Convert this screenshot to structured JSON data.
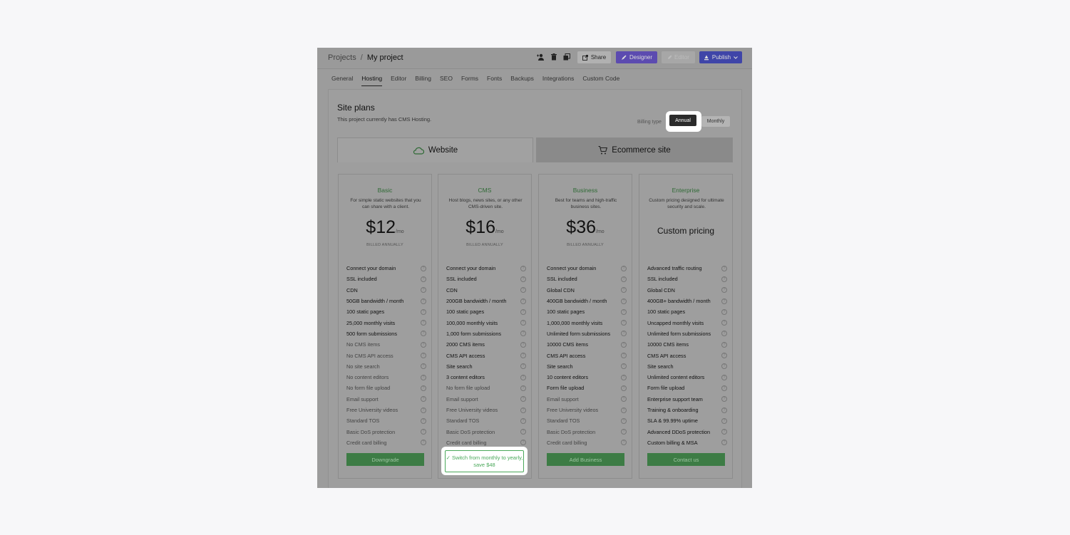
{
  "breadcrumb": {
    "root": "Projects",
    "separator": "/",
    "current": "My project"
  },
  "toolbar": {
    "share_label": "Share",
    "designer_label": "Designer",
    "editor_label": "Editor",
    "publish_label": "Publish"
  },
  "tabs": [
    "General",
    "Hosting",
    "Editor",
    "Billing",
    "SEO",
    "Forms",
    "Fonts",
    "Backups",
    "Integrations",
    "Custom Code"
  ],
  "site_plans": {
    "title": "Site plans",
    "subtitle": "This project currently has CMS Hosting.",
    "billing_type_label": "Billing type",
    "annual_label": "Annual",
    "monthly_label": "Monthly",
    "plan_tabs": {
      "website": "Website",
      "ecommerce": "Ecommerce site"
    }
  },
  "plans": [
    {
      "name": "Basic",
      "desc": "For simple static websites that you can share with a client.",
      "price": "$12",
      "per": "/mo",
      "billed": "BILLED ANNUALLY",
      "features": [
        "Connect your domain",
        "SSL included",
        "CDN",
        "50GB bandwidth / month",
        "100 static pages",
        "25,000 monthly visits",
        "500 form submissions",
        "No CMS items",
        "No CMS API access",
        "No site search",
        "No content editors",
        "No form file upload",
        "Email support",
        "Free University videos",
        "Standard TOS",
        "Basic DoS protection",
        "Credit card billing"
      ],
      "action": "Downgrade"
    },
    {
      "name": "CMS",
      "desc": "Host blogs, news sites, or any other CMS-driven site.",
      "price": "$16",
      "per": "/mo",
      "billed": "BILLED ANNUALLY",
      "features": [
        "Connect your domain",
        "SSL included",
        "CDN",
        "200GB bandwidth / month",
        "100 static pages",
        "100,000 monthly visits",
        "1,000 form submissions",
        "2000 CMS items",
        "CMS API access",
        "Site search",
        "3 content editors",
        "No form file upload",
        "Email support",
        "Free University videos",
        "Standard TOS",
        "Basic DoS protection",
        "Credit card billing"
      ],
      "action": "Switch from monthly to yearly, save $48"
    },
    {
      "name": "Business",
      "desc": "Best for teams and high-traffic business sites.",
      "price": "$36",
      "per": "/mo",
      "billed": "BILLED ANNUALLY",
      "features": [
        "Connect your domain",
        "SSL included",
        "Global CDN",
        "400GB bandwidth / month",
        "100 static pages",
        "1,000,000 monthly visits",
        "Unlimited form submissions",
        "10000 CMS items",
        "CMS API access",
        "Site search",
        "10 content editors",
        "Form file upload",
        "Email support",
        "Free University videos",
        "Standard TOS",
        "Basic DoS protection",
        "Credit card billing"
      ],
      "action": "Add Business"
    },
    {
      "name": "Enterprise",
      "desc": "Custom pricing designed for ultimate security and scale.",
      "custom": "Custom pricing",
      "features": [
        "Advanced traffic routing",
        "SSL included",
        "Global CDN",
        "400GB+ bandwidth / month",
        "100 static pages",
        "Uncapped monthly visits",
        "Unlimited form submissions",
        "10000 CMS items",
        "CMS API access",
        "Site search",
        "Unlimited content editors",
        "Form file upload",
        "Enterprise support team",
        "Training & onboarding",
        "SLA & 99.99% uptime",
        "Advanced DDoS protection",
        "Custom billing & MSA"
      ],
      "action": "Contact us"
    }
  ]
}
